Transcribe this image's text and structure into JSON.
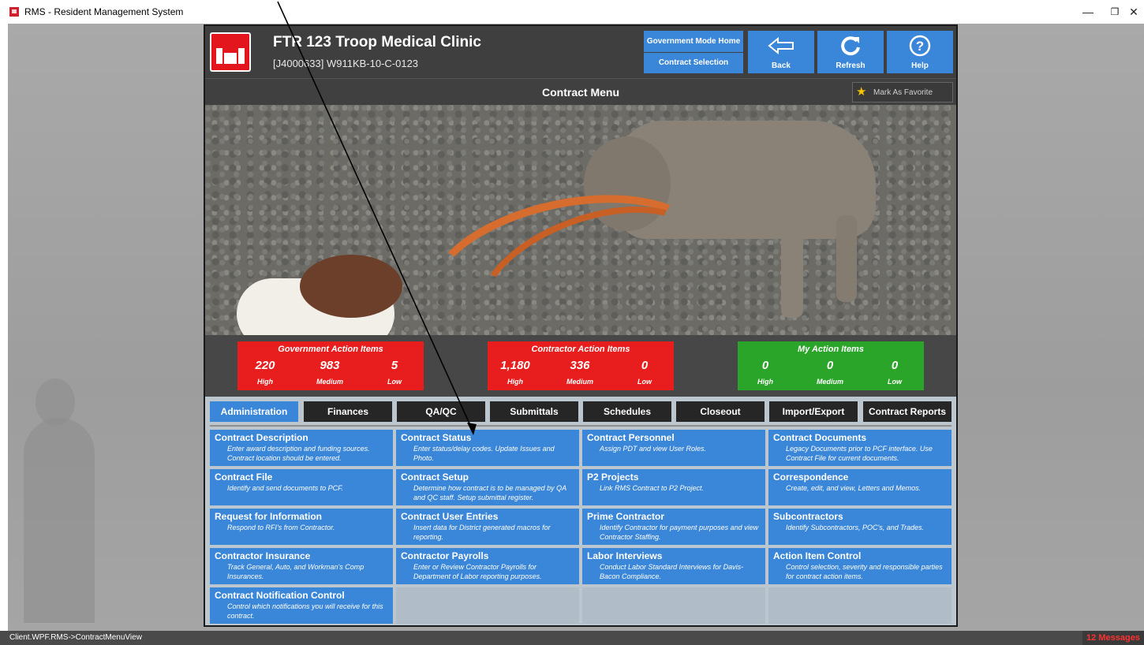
{
  "window": {
    "title": "RMS - Resident Management System",
    "minimize": "—",
    "maximize": "❐",
    "close": "✕"
  },
  "header": {
    "contract_title": "FTR 123 Troop Medical Clinic",
    "contract_number": "[J4000633] W911KB-10-C-0123",
    "gov_mode_home": "Government Mode Home",
    "contract_selection": "Contract Selection",
    "back_label": "Back",
    "refresh_label": "Refresh",
    "help_label": "Help"
  },
  "menu": {
    "title": "Contract Menu",
    "favorite_label": "Mark As Favorite"
  },
  "action_items": {
    "government": {
      "title": "Government Action Items",
      "high": "220",
      "medium": "983",
      "low": "5"
    },
    "contractor": {
      "title": "Contractor Action Items",
      "high": "1,180",
      "medium": "336",
      "low": "0"
    },
    "my": {
      "title": "My Action Items",
      "high": "0",
      "medium": "0",
      "low": "0"
    },
    "labels": {
      "high": "High",
      "medium": "Medium",
      "low": "Low"
    }
  },
  "tabs": [
    {
      "label": "Administration"
    },
    {
      "label": "Finances"
    },
    {
      "label": "QA/QC"
    },
    {
      "label": "Submittals"
    },
    {
      "label": "Schedules"
    },
    {
      "label": "Closeout"
    },
    {
      "label": "Import/Export"
    },
    {
      "label": "Contract Reports"
    }
  ],
  "tiles": [
    {
      "title": "Contract Description",
      "desc": "Enter award description and funding sources. Contract location should be entered."
    },
    {
      "title": "Contract Status",
      "desc": "Enter status/delay codes. Update Issues and Photo."
    },
    {
      "title": "Contract Personnel",
      "desc": "Assign PDT and view User Roles."
    },
    {
      "title": "Contract Documents",
      "desc": "Legacy Documents prior to PCF interface. Use Contract File for current documents."
    },
    {
      "title": "Contract File",
      "desc": "Identify and send documents to PCF."
    },
    {
      "title": "Contract Setup",
      "desc": "Determine how contract is to be managed by QA and QC staff. Setup submittal register."
    },
    {
      "title": "P2 Projects",
      "desc": "Link RMS Contract to P2 Project."
    },
    {
      "title": "Correspondence",
      "desc": "Create, edit, and view, Letters and Memos."
    },
    {
      "title": "Request for Information",
      "desc": "Respond to RFI's from Contractor."
    },
    {
      "title": "Contract User Entries",
      "desc": "Insert data for District generated macros for reporting."
    },
    {
      "title": "Prime Contractor",
      "desc": "Identify Contractor for payment purposes and view Contractor Staffing."
    },
    {
      "title": "Subcontractors",
      "desc": "Identify Subcontractors, POC's, and Trades."
    },
    {
      "title": "Contractor Insurance",
      "desc": "Track General, Auto, and Workman's Comp Insurances."
    },
    {
      "title": "Contractor Payrolls",
      "desc": "Enter or Review Contractor Payrolls for Department of Labor reporting purposes."
    },
    {
      "title": "Labor Interviews",
      "desc": "Conduct Labor Standard Interviews for Davis-Bacon Compliance."
    },
    {
      "title": "Action Item Control",
      "desc": "Control selection, severity and responsible parties for contract action items."
    },
    {
      "title": "Contract Notification Control",
      "desc": "Control which notifications you will receive for this contract."
    }
  ],
  "status": {
    "path": "Client.WPF.RMS->ContractMenuView",
    "messages": "12 Messages"
  }
}
